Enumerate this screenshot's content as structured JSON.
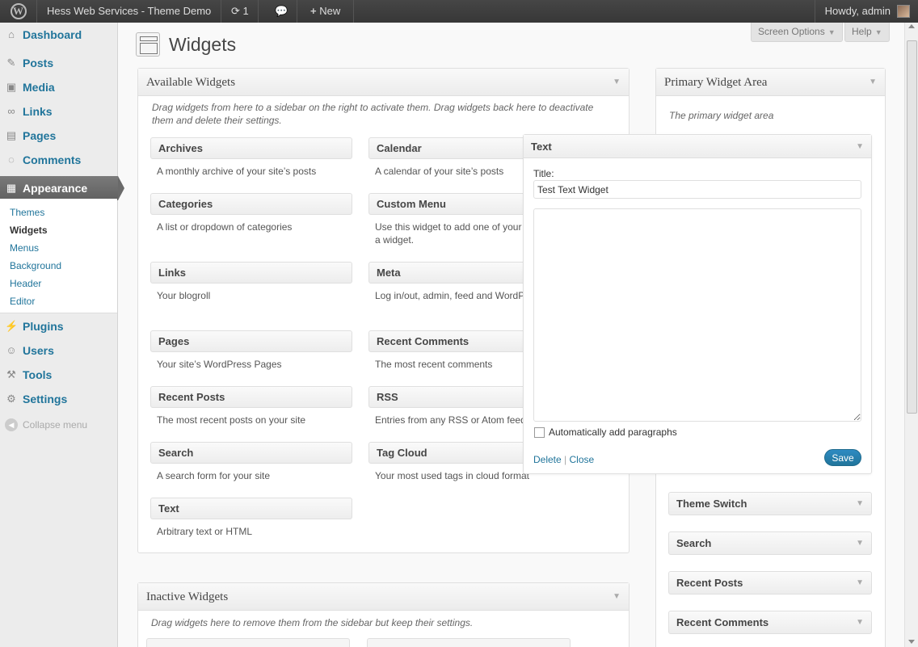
{
  "adminbar": {
    "site_name": "Hess Web Services - Theme Demo",
    "updates_icon": "refresh-icon",
    "updates_count": "1",
    "comments_icon": "speech-bubble-icon",
    "new_label": "New",
    "howdy": "Howdy, admin"
  },
  "menu": {
    "dashboard": "Dashboard",
    "posts": "Posts",
    "media": "Media",
    "links": "Links",
    "pages": "Pages",
    "comments": "Comments",
    "appearance": "Appearance",
    "plugins": "Plugins",
    "users": "Users",
    "tools": "Tools",
    "settings": "Settings",
    "collapse": "Collapse menu",
    "submenu": {
      "themes": "Themes",
      "widgets": "Widgets",
      "menus": "Menus",
      "background": "Background",
      "header": "Header",
      "editor": "Editor"
    }
  },
  "header": {
    "title": "Widgets",
    "screen_options": "Screen Options",
    "help": "Help"
  },
  "available": {
    "title": "Available Widgets",
    "description": "Drag widgets from here to a sidebar on the right to activate them. Drag widgets back here to deactivate them and delete their settings.",
    "widgets": [
      {
        "title": "Archives",
        "desc": "A monthly archive of your site’s posts"
      },
      {
        "title": "Calendar",
        "desc": "A calendar of your site’s posts"
      },
      {
        "title": "Categories",
        "desc": "A list or dropdown of categories"
      },
      {
        "title": "Custom Menu",
        "desc": "Use this widget to add one of your menus as a widget."
      },
      {
        "title": "Links",
        "desc": "Your blogroll"
      },
      {
        "title": "Meta",
        "desc": "Log in/out, admin, feed and WordPress links"
      },
      {
        "title": "Pages",
        "desc": "Your site’s WordPress Pages"
      },
      {
        "title": "Recent Comments",
        "desc": "The most recent comments"
      },
      {
        "title": "Recent Posts",
        "desc": "The most recent posts on your site"
      },
      {
        "title": "RSS",
        "desc": "Entries from any RSS or Atom feed"
      },
      {
        "title": "Search",
        "desc": "A search form for your site"
      },
      {
        "title": "Tag Cloud",
        "desc": "Your most used tags in cloud format"
      },
      {
        "title": "Text",
        "desc": "Arbitrary text or HTML"
      }
    ]
  },
  "inactive": {
    "title": "Inactive Widgets",
    "description": "Drag widgets here to remove them from the sidebar but keep their settings."
  },
  "primary": {
    "title": "Primary Widget Area",
    "description": "The primary widget area",
    "widgets": [
      "Theme Switch",
      "Search",
      "Recent Posts",
      "Recent Comments"
    ]
  },
  "text_widget": {
    "title": "Text",
    "title_label": "Title:",
    "title_value": "Test Text Widget",
    "auto_paragraphs": "Automatically add paragraphs",
    "delete": "Delete",
    "separator": "|",
    "close": "Close",
    "save": "Save"
  }
}
